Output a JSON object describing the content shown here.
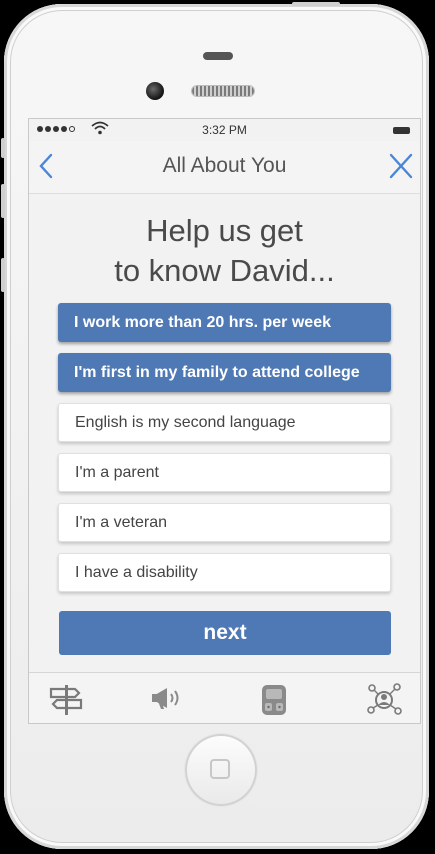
{
  "status_bar": {
    "time": "3:32 PM"
  },
  "nav": {
    "title": "All About You"
  },
  "heading": {
    "line1": "Help us get",
    "line2": "to know David..."
  },
  "options": [
    {
      "label": "I work more than 20 hrs. per week",
      "selected": true
    },
    {
      "label": "I'm first in my family to attend college",
      "selected": true
    },
    {
      "label": "English is my second language",
      "selected": false
    },
    {
      "label": "I'm a parent",
      "selected": false
    },
    {
      "label": "I'm a veteran",
      "selected": false
    },
    {
      "label": "I have a disability",
      "selected": false
    }
  ],
  "next_label": "next",
  "tabs": [
    "signpost-icon",
    "megaphone-icon",
    "backpack-icon",
    "network-icon"
  ],
  "colors": {
    "accent": "#4f79b5",
    "nav_icon": "#4a86d6"
  }
}
